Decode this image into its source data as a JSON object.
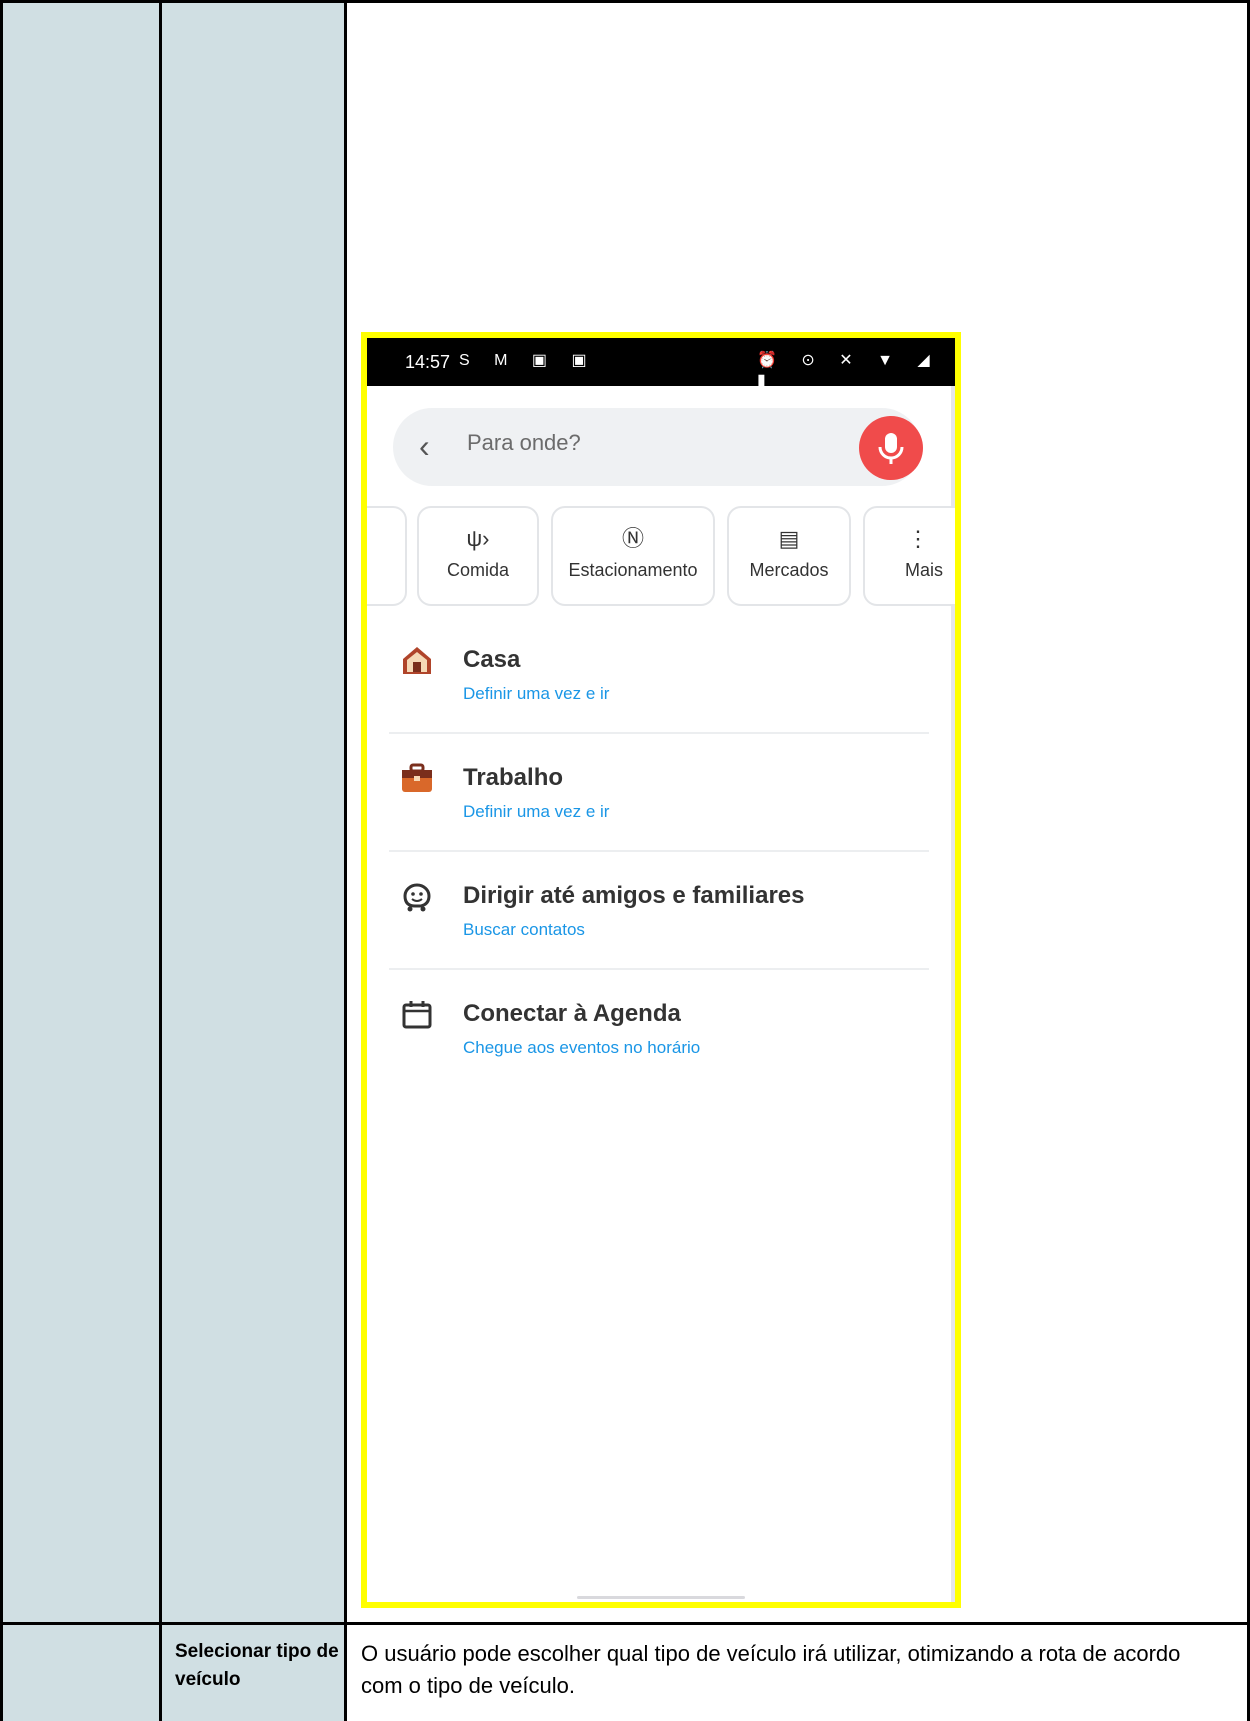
{
  "row": {
    "label": "Selecionar tipo de veículo",
    "description": "O usuário pode escolher qual tipo de veículo irá utilizar, otimizando a rota de acordo com o tipo de veículo."
  },
  "phone": {
    "status_bar": {
      "time": "14:57",
      "left_icons": "S M ▣ ▣",
      "right_icons": "⏰ ⊙ ✕ ▼ ◢ ▮"
    },
    "search": {
      "placeholder": "Para onde?",
      "back_icon": "chevron-left-icon",
      "mic_icon": "microphone-icon",
      "mic_color": "#f04b4b"
    },
    "categories": [
      {
        "label": "",
        "icon": ""
      },
      {
        "label": "Comida",
        "icon": "fork-knife-icon"
      },
      {
        "label": "Estacionamento",
        "icon": "parking-icon"
      },
      {
        "label": "Mercados",
        "icon": "cart-icon"
      },
      {
        "label": "Mais",
        "icon": "more-vertical-icon"
      }
    ],
    "shortcuts": [
      {
        "title": "Casa",
        "subtitle": "Definir uma vez e ir",
        "icon": "home-icon"
      },
      {
        "title": "Trabalho",
        "subtitle": "Definir uma vez e ir",
        "icon": "briefcase-icon"
      },
      {
        "title": "Dirigir até amigos e familiares",
        "subtitle": "Buscar contatos",
        "icon": "waze-face-icon"
      },
      {
        "title": "Conectar à Agenda",
        "subtitle": "Chegue aos eventos no horário",
        "icon": "calendar-icon"
      }
    ],
    "link_color": "#1a96e6",
    "highlight_color": "#ffff00"
  }
}
